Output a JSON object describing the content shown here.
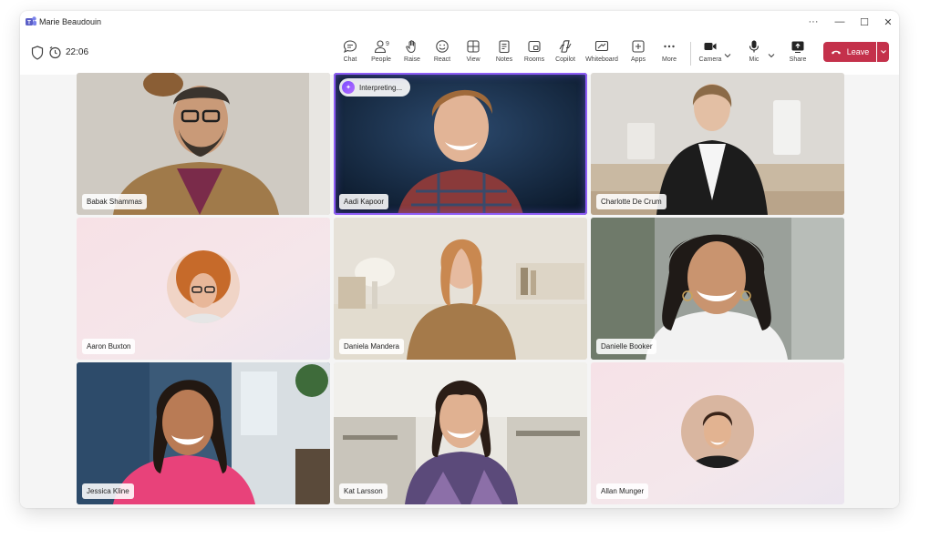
{
  "window": {
    "title": "Marie Beaudouin",
    "controls": {
      "more": "···",
      "minimize": "—",
      "maximize": "☐",
      "close": "✕"
    }
  },
  "meeting": {
    "time": "22:06"
  },
  "toolbar": {
    "chat": "Chat",
    "people": "People",
    "people_count": "9",
    "raise": "Raise",
    "react": "React",
    "view": "View",
    "notes": "Notes",
    "rooms": "Rooms",
    "copilot": "Copilot",
    "whiteboard": "Whiteboard",
    "apps": "Apps",
    "more": "More",
    "camera": "Camera",
    "mic": "Mic",
    "share": "Share",
    "leave": "Leave"
  },
  "participants": [
    {
      "name": "Babak Shammas",
      "video": true
    },
    {
      "name": "Aadi Kapoor",
      "video": true,
      "active_speaker": true,
      "status": "Interpreting..."
    },
    {
      "name": "Charlotte De Crum",
      "video": true
    },
    {
      "name": "Aaron Buxton",
      "video": false
    },
    {
      "name": "Daniela Mandera",
      "video": true
    },
    {
      "name": "Danielle Booker",
      "video": true
    },
    {
      "name": "Jessica Kline",
      "video": true
    },
    {
      "name": "Kat Larsson",
      "video": true
    },
    {
      "name": "Allan Munger",
      "video": false
    }
  ],
  "colors": {
    "brand": "#5b5fc7",
    "leave": "#c4314b",
    "active_speaker": "#8d5cf6"
  }
}
